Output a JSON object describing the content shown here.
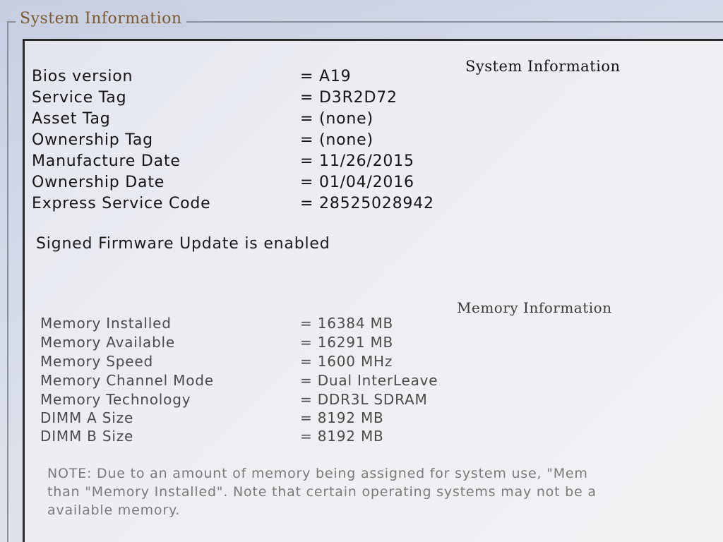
{
  "window": {
    "group_title": "System Information"
  },
  "system": {
    "heading": "System Information",
    "rows": [
      {
        "label": "Bios version",
        "value": "= A19"
      },
      {
        "label": "Service Tag",
        "value": "= D3R2D72"
      },
      {
        "label": "Asset Tag",
        "value": "= (none)"
      },
      {
        "label": "Ownership Tag",
        "value": "= (none)"
      },
      {
        "label": "Manufacture Date",
        "value": "= 11/26/2015"
      },
      {
        "label": "Ownership Date",
        "value": "= 01/04/2016"
      },
      {
        "label": "Express Service Code",
        "value": "= 28525028942"
      }
    ],
    "firmware_status": "Signed Firmware Update is enabled"
  },
  "memory": {
    "heading": "Memory Information",
    "rows": [
      {
        "label": "Memory Installed",
        "value": "= 16384 MB"
      },
      {
        "label": "Memory Available",
        "value": "= 16291 MB"
      },
      {
        "label": "Memory Speed",
        "value": "= 1600 MHz"
      },
      {
        "label": "Memory Channel Mode",
        "value": "= Dual InterLeave"
      },
      {
        "label": "Memory Technology",
        "value": "= DDR3L SDRAM"
      },
      {
        "label": "DIMM A Size",
        "value": "= 8192 MB"
      },
      {
        "label": "DIMM B Size",
        "value": "= 8192 MB"
      }
    ],
    "note_lines": [
      "NOTE: Due to an amount of memory being assigned for system use, \"Mem",
      "than \"Memory Installed\". Note that certain operating systems may not be a",
      "available memory."
    ]
  }
}
